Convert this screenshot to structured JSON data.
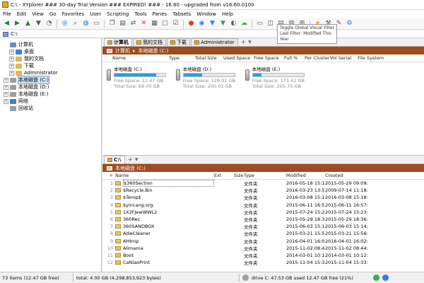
{
  "window": {
    "title": "C:\\ - XYplorer ### 30-day Trial Version ### EXPIRED! ### - 16.80 - upgraded from v16.60.0100"
  },
  "menu": [
    "File",
    "Edit",
    "View",
    "Go",
    "Favorites",
    "User",
    "Scripting",
    "Tools",
    "Panes",
    "Tabsets",
    "Window",
    "Help"
  ],
  "toolbar": {
    "icons": [
      "back-icon",
      "forward-icon",
      "up-icon",
      "down-arrow-icon",
      "history-icon",
      "target-icon",
      "search-icon",
      "globe-icon",
      "new-tab-icon",
      "copy-icon",
      "paste-icon",
      "move-icon",
      "delete-icon",
      "properties-icon",
      "window-icon",
      "checkbox-icon",
      "color-filter-icon",
      "find-icon",
      "funnel-icon",
      "funnel-green-icon",
      "visual-filter-icon",
      "cloud-icon",
      "layout-single-icon",
      "layout-dual-icon",
      "layout-horizontal-icon",
      "layout-vertical-icon",
      "layout-quad-icon",
      "favorites-icon",
      "tools-icon",
      "brush-icon",
      "settings-icon"
    ],
    "tooltip_line1": "Toggle Global Visual Filter",
    "tooltip_line2": "Last Filter: Modified This Year"
  },
  "address": {
    "value": "C:\\"
  },
  "tree": [
    {
      "label": "计算机",
      "level": 0,
      "glyph": "",
      "color": "#6a8fbf"
    },
    {
      "label": "桌面",
      "level": 1,
      "glyph": "+",
      "color": "#3d7fd6"
    },
    {
      "label": "我的文档",
      "level": 1,
      "glyph": "+",
      "color": "#e2b84a"
    },
    {
      "label": "下载",
      "level": 1,
      "glyph": "+",
      "color": "#e2b84a"
    },
    {
      "label": "Administrator",
      "level": 1,
      "glyph": "+",
      "color": "#e2b84a"
    },
    {
      "label": "本地磁盘 (C:)",
      "level": 0,
      "glyph": "+",
      "color": "#9e9e9e",
      "selected": true
    },
    {
      "label": "本地磁盘 (D:)",
      "level": 0,
      "glyph": "+",
      "color": "#9e9e9e"
    },
    {
      "label": "本地磁盘 (E:)",
      "level": 0,
      "glyph": "+",
      "color": "#9e9e9e"
    },
    {
      "label": "网络",
      "level": 0,
      "glyph": "+",
      "color": "#4a7bbf"
    },
    {
      "label": "回收站",
      "level": 0,
      "glyph": "",
      "color": "#8aa0b8"
    }
  ],
  "pane1": {
    "tabs": [
      {
        "label": "计算机",
        "active": true
      },
      {
        "label": "我的文档",
        "active": false
      },
      {
        "label": "下载",
        "active": false
      },
      {
        "label": "Administrator",
        "active": false
      }
    ],
    "tab_extra": "+ ▾",
    "breadcrumb": [
      "计算机",
      "本地磁盘 (C:)"
    ],
    "columns": [
      "Name",
      "Type",
      "Total Size",
      "Used Space",
      "Free Space",
      "Full %",
      "Per Cluster",
      "Vol Serial",
      "File System"
    ],
    "drives": [
      {
        "name": "本地磁盘 (C:)",
        "free": "Free Space: 12.47 GB",
        "total": "Total Size: 68.00 GB",
        "used_fraction": 0.82
      },
      {
        "name": "本地磁盘 (D:)",
        "free": "Free Space: 126.01 GB",
        "total": "Total Size: 200.01 GB",
        "used_fraction": 0.37
      },
      {
        "name": "本地磁盘 (E:)",
        "free": "Free Space: 171.42 GB",
        "total": "Total Size: 205.75 GB",
        "used_fraction": 0.17
      }
    ]
  },
  "pane2": {
    "tabs": [
      {
        "label": "C:\\",
        "active": true
      }
    ],
    "tab_extra": "+ ▾",
    "breadcrumb": [
      "本地磁盘 (C:)"
    ],
    "columns": [
      "#",
      "Name",
      "Ext",
      "Size",
      "Type",
      "Modified",
      "Created"
    ],
    "rows": [
      {
        "num": "1",
        "name": "$360Section",
        "type": "文件夹",
        "modified": "2016-05-18 15:15:...",
        "created": "2015-05-29 09:09:...",
        "sel": true
      },
      {
        "num": "2",
        "name": "$Recycle.Bin",
        "type": "文件夹",
        "modified": "2016-03-23 13:59:...",
        "created": "2009-07-14 11:18:..."
      },
      {
        "num": "3",
        "name": "$Temp$",
        "type": "文件夹",
        "modified": "2016-03-08 15:18:...",
        "created": "2016-03-08 15:18:..."
      },
      {
        "num": "4",
        "name": "$yincang.org.",
        "type": "文件夹",
        "modified": "2015-06-11 16:57:...",
        "created": "2015-06-11 16:57:..."
      },
      {
        "num": "5",
        "name": "1X2FJewWWL2",
        "type": "文件夹",
        "modified": "2015-07-24 15:23:...",
        "created": "2015-07-24 15:23:..."
      },
      {
        "num": "6",
        "name": "360Rec",
        "type": "文件夹",
        "modified": "2015-05-29 18:36:...",
        "created": "2015-05-29 18:36:..."
      },
      {
        "num": "7",
        "name": "360SANDBOX",
        "type": "文件夹",
        "modified": "2015-06-03 15:14:...",
        "created": "2015-06-03 15:14:..."
      },
      {
        "num": "8",
        "name": "AdwCleaner",
        "type": "文件夹",
        "modified": "2015-03-21 15:56:...",
        "created": "2015-03-21 15:56:..."
      },
      {
        "num": "9",
        "name": "AHtmp",
        "type": "文件夹",
        "modified": "2016-04-01 16:02:...",
        "created": "2016-04-01 16:02:..."
      },
      {
        "num": "10",
        "name": "Alimama",
        "type": "文件夹",
        "modified": "2015-11-02 08:44:...",
        "created": "2015-11-02 08:44:..."
      },
      {
        "num": "11",
        "name": "Boot",
        "type": "文件夹",
        "modified": "2014-03-01 10:12:...",
        "created": "2014-03-01 10:12:..."
      },
      {
        "num": "12",
        "name": "CaNiaoPrint",
        "type": "文件夹",
        "modified": "2015-11-04 15:33:...",
        "created": "2015-11-04 15:33:..."
      }
    ]
  },
  "status": {
    "items": "73 items (12.47 GB free)",
    "total": "total: 4.00 GB (4,298,853,923 bytes)",
    "drive": "drive C:  47.53 GB used  12.47 GB free (21%)"
  }
}
